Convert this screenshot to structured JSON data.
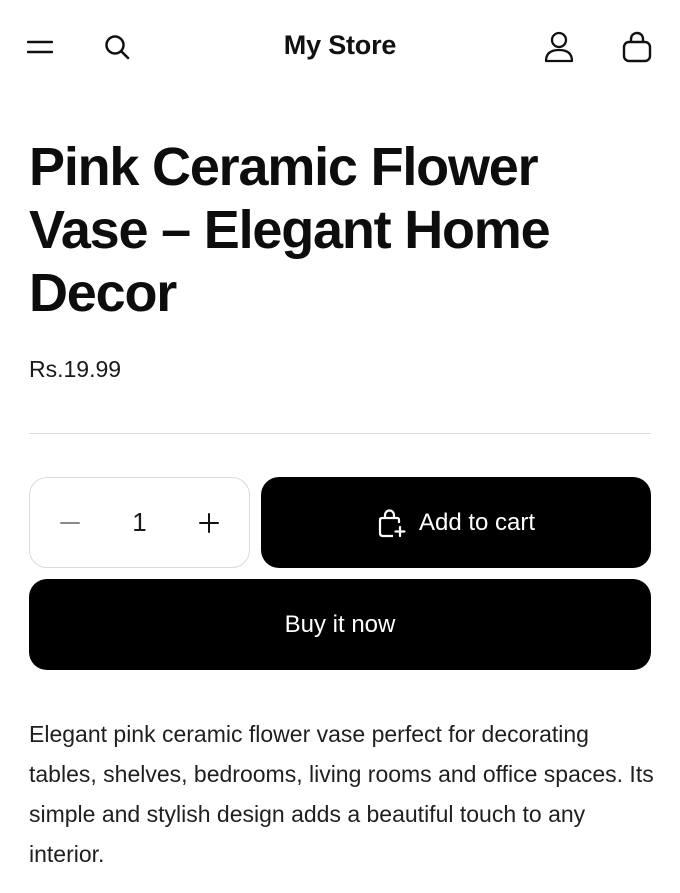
{
  "header": {
    "store_name": "My Store"
  },
  "product": {
    "title": "Pink Ceramic Flower Vase – Elegant Home Decor",
    "price": "Rs.19.99",
    "quantity": "1",
    "add_to_cart_label": "Add to cart",
    "buy_now_label": "Buy it now",
    "description": "Elegant pink ceramic flower vase perfect for decorating tables, shelves, bedrooms, living rooms and office spaces. Its simple and stylish design adds a beautiful touch to any interior."
  },
  "icons": {
    "menu": "menu-icon",
    "search": "search-icon",
    "account": "user-icon",
    "cart": "bag-icon",
    "minus": "minus-icon",
    "plus": "plus-icon",
    "add_to_cart": "bag-plus-icon"
  },
  "colors": {
    "primary_button": "#000000",
    "button_text": "#ffffff",
    "divider": "#dcdcdc"
  }
}
